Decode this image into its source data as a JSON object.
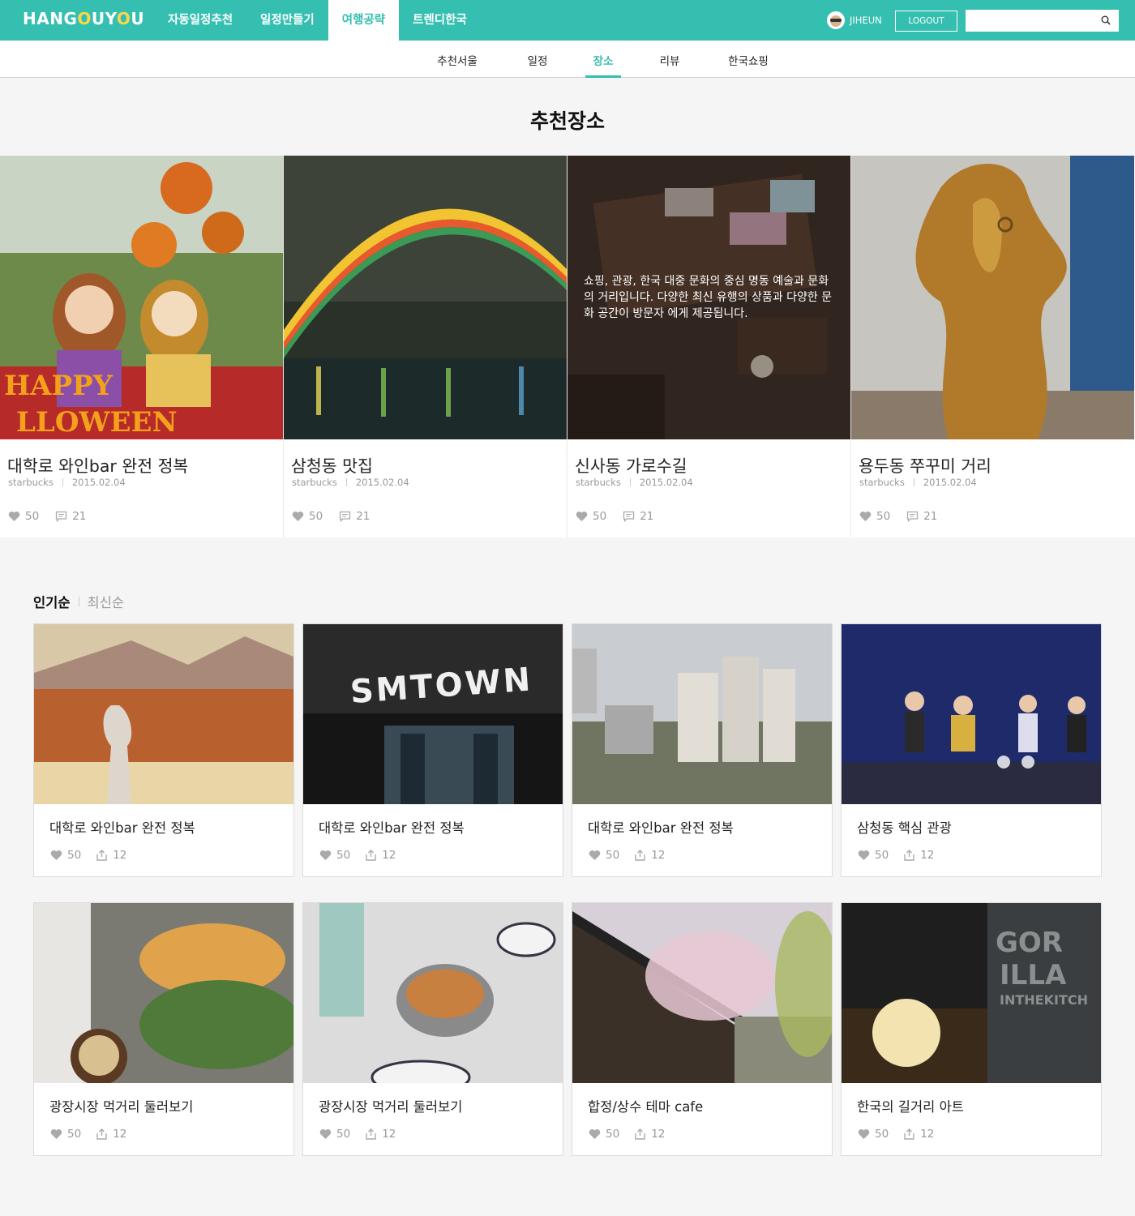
{
  "header": {
    "logo_text": "HANGOUYOU",
    "nav": [
      {
        "label": "자동일정추천",
        "active": false
      },
      {
        "label": "일정만들기",
        "active": false
      },
      {
        "label": "여행공략",
        "active": true
      },
      {
        "label": "트렌디한국",
        "active": false
      }
    ],
    "username": "JIHEUN",
    "logout_label": "LOGOUT",
    "search_placeholder": ""
  },
  "subnav": [
    {
      "label": "추천서울",
      "active": false
    },
    {
      "label": "일정",
      "active": false
    },
    {
      "label": "장소",
      "active": true
    },
    {
      "label": "리뷰",
      "active": false
    },
    {
      "label": "한국쇼핑",
      "active": false
    }
  ],
  "section_title": "추천장소",
  "featured": [
    {
      "title": "대학로 와인bar 완전 정복",
      "author": "starbucks",
      "date": "2015.02.04",
      "likes": "50",
      "comments": "21",
      "overlay": ""
    },
    {
      "title": "삼청동 맛집",
      "author": "starbucks",
      "date": "2015.02.04",
      "likes": "50",
      "comments": "21",
      "overlay": ""
    },
    {
      "title": "신사동 가로수길",
      "author": "starbucks",
      "date": "2015.02.04",
      "likes": "50",
      "comments": "21",
      "overlay": "쇼핑, 관광, 한국 대중 문화의 중심 명동 예술과 문화의 거리입니다. 다양한 최신 유행의 상품과 다양한 문화 공간이 방문자 에게 제공됩니다."
    },
    {
      "title": "용두동 쭈꾸미 거리",
      "author": "starbucks",
      "date": "2015.02.04",
      "likes": "50",
      "comments": "21",
      "overlay": ""
    }
  ],
  "sort": {
    "popular": "인기순",
    "latest": "최신순"
  },
  "cards": [
    {
      "title": "대학로 와인bar 완전 정복",
      "likes": "50",
      "shares": "12"
    },
    {
      "title": "대학로 와인bar 완전 정복",
      "likes": "50",
      "shares": "12"
    },
    {
      "title": "대학로 와인bar 완전 정복",
      "likes": "50",
      "shares": "12"
    },
    {
      "title": "삼청동 핵심 관광",
      "likes": "50",
      "shares": "12"
    },
    {
      "title": "광장시장 먹거리 둘러보기",
      "likes": "50",
      "shares": "12"
    },
    {
      "title": "광장시장 먹거리 둘러보기",
      "likes": "50",
      "shares": "12"
    },
    {
      "title": "합정/상수 테마 cafe",
      "likes": "50",
      "shares": "12"
    },
    {
      "title": "한국의 길거리 아트",
      "likes": "50",
      "shares": "12"
    }
  ],
  "photo_signs": {
    "smtown": "SMTOWN",
    "gorilla_1": "GOR",
    "gorilla_2": "ILLA",
    "gorilla_3": "INTHEKITCH",
    "happy": "HAPPY",
    "halloween": "LLOWEEN"
  },
  "colors": {
    "brand": "#35bfb0",
    "logo_accent": "#f7d84a"
  }
}
